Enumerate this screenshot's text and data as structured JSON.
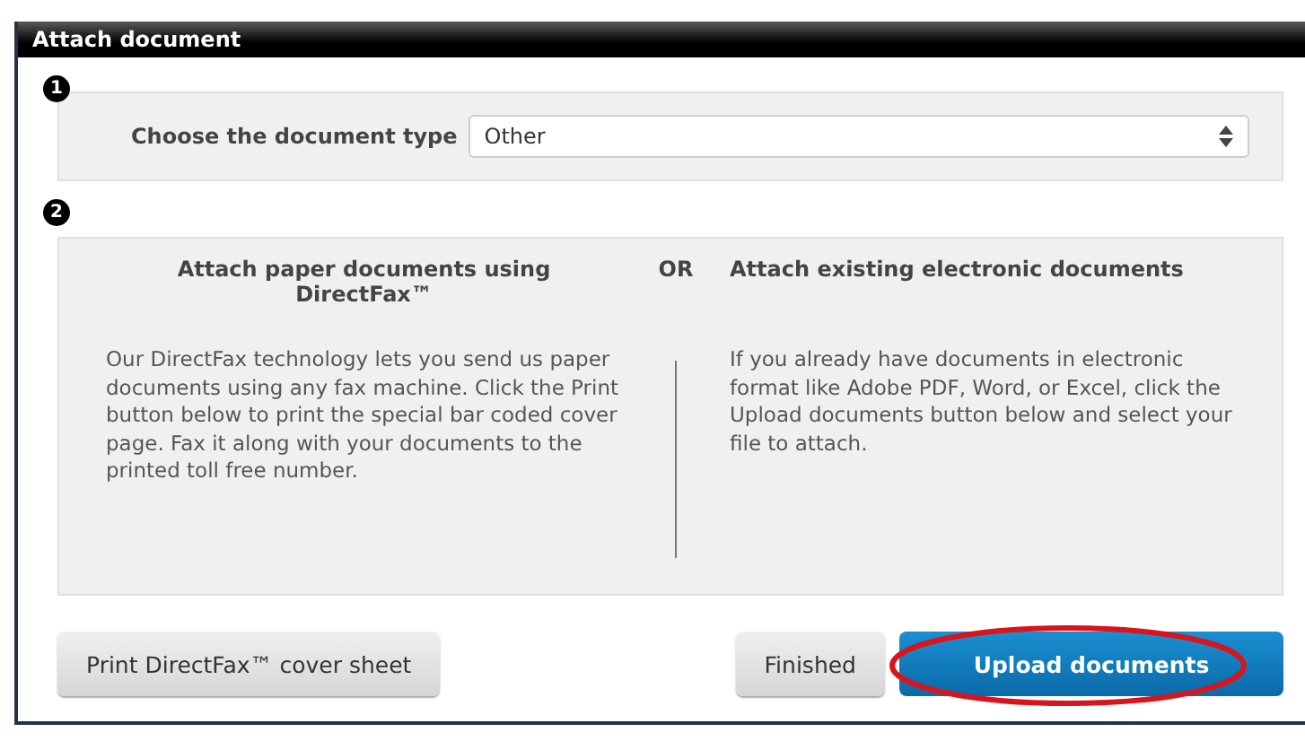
{
  "window": {
    "title": "Attach document"
  },
  "step1": {
    "number": "1",
    "label": "Choose the document type",
    "select": {
      "value": "Other"
    }
  },
  "step2": {
    "number": "2",
    "separator": "OR",
    "left": {
      "heading": "Attach paper documents using DirectFax™",
      "body": "Our DirectFax technology lets you send us paper documents using any fax machine. Click the Print button below to print the special bar coded cover page. Fax it along with your documents to the printed toll free number."
    },
    "right": {
      "heading": "Attach existing electronic documents",
      "body": "If you already have documents in electronic format like Adobe PDF, Word, or Excel, click the Upload documents button below and select your file to attach."
    }
  },
  "buttons": [
    {
      "label": "Print DirectFax™ cover sheet",
      "kind": "default",
      "highlighted": false
    },
    {
      "label": "Finished",
      "kind": "default",
      "highlighted": false
    },
    {
      "label": "Upload documents",
      "kind": "primary",
      "highlighted": true
    }
  ]
}
